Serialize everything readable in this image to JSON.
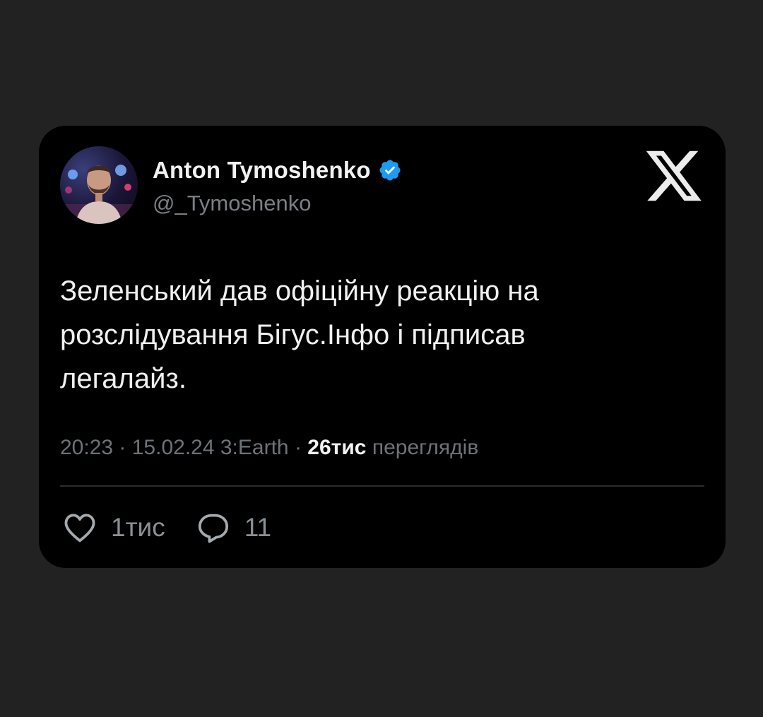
{
  "author": {
    "name": "Anton Tymoshenko",
    "handle": "@_Tymoshenko",
    "verified": true
  },
  "tweet": {
    "text_lines": [
      "Зеленський дав офіційну реакцію на",
      "розслідування Бігус.Інфо і підписав",
      "легалайз."
    ]
  },
  "meta": {
    "time": "20:23",
    "date": "15.02.24",
    "source": "3:Earth",
    "separator": " · ",
    "views_count": "26тис",
    "views_label": "переглядів"
  },
  "actions": {
    "likes": "1тис",
    "replies": "11"
  },
  "icons": {
    "verified": "verified-badge-icon",
    "brand": "x-logo-icon",
    "like": "heart-icon",
    "reply": "comment-icon"
  },
  "colors": {
    "background": "#222222",
    "card": "#000000",
    "verified": "#1d9bf0",
    "muted_text": "#6e7378"
  }
}
